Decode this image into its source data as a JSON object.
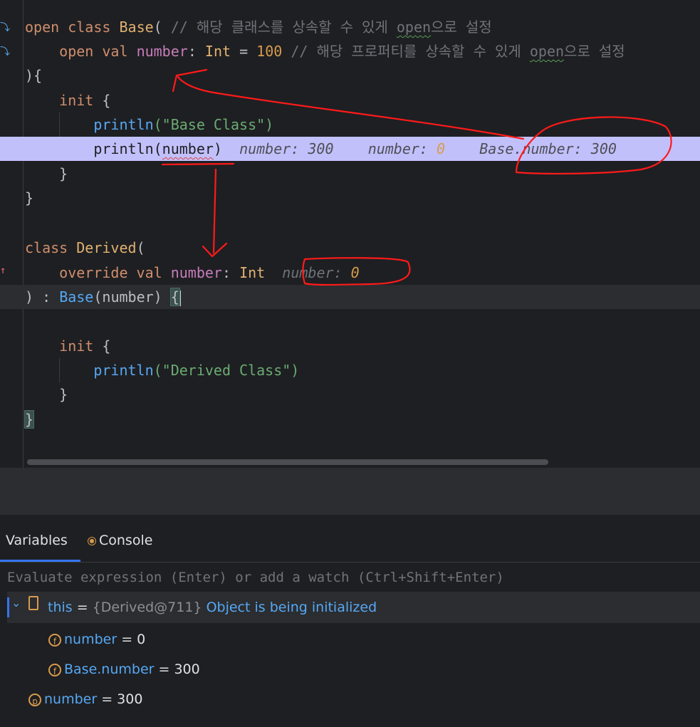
{
  "code": {
    "line1": {
      "kw1": "open",
      "kw2": "class",
      "name": "Base",
      "paren": "(",
      "comment_prefix": "// 해당 클래스를 상속할 수 있게 ",
      "comment_open": "open",
      "comment_suffix": "으로 설정"
    },
    "line2": {
      "kw1": "open",
      "kw2": "val",
      "name": "number",
      "colon": ":",
      "type": "Int",
      "eq": "=",
      "value": "100",
      "comment_prefix": "// 해당 프로퍼티를 상속할 수 있게 ",
      "comment_open": "open",
      "comment_suffix": "으로 설정"
    },
    "line3": "){",
    "line4": {
      "kw": "init",
      "brace": "{"
    },
    "line5": {
      "fn": "println",
      "arg": "(\"Base Class\")"
    },
    "line6": {
      "fn": "println",
      "open": "(",
      "arg": "number",
      "close": ")",
      "hint1_label": "number: ",
      "hint1_value": "300",
      "hint2_label": "number: ",
      "hint2_value": "0",
      "hint3_label": "Base.number: ",
      "hint3_value": "300"
    },
    "line7": "}",
    "line8": "}",
    "line10": {
      "kw": "class",
      "name": "Derived",
      "paren": "("
    },
    "line11": {
      "kw1": "override",
      "kw2": "val",
      "name": "number",
      "colon": ":",
      "type": "Int",
      "hint_label": "number: ",
      "hint_value": "0"
    },
    "line12": {
      "close": ")",
      "colon": ":",
      "super": "Base",
      "arg_open": "(",
      "arg": "number",
      "arg_close": ")",
      "brace": "{"
    },
    "line14": {
      "kw": "init",
      "brace": "{"
    },
    "line15": {
      "fn": "println",
      "arg": "(\"Derived Class\")"
    },
    "line16": "}",
    "line17": "}"
  },
  "debugger": {
    "tabs": [
      {
        "label": "Variables",
        "active": true
      },
      {
        "label": "Console",
        "active": false
      }
    ],
    "eval_placeholder": "Evaluate expression (Enter) or add a watch (Ctrl+Shift+Enter)",
    "this_row": {
      "name": "this",
      "eq": " = ",
      "value": "{Derived@711}",
      "status": "Object is being initialized"
    },
    "fields": [
      {
        "name": "number",
        "eq": " = ",
        "value": "0"
      },
      {
        "name": "Base.number",
        "eq": " = ",
        "value": "300"
      }
    ],
    "param": {
      "name": "number",
      "eq": " = ",
      "value": "300"
    }
  },
  "colors": {
    "accent": "#3574f0",
    "breakpoint_line": "#c2c0fb",
    "annotation": "#ff1a1a"
  }
}
